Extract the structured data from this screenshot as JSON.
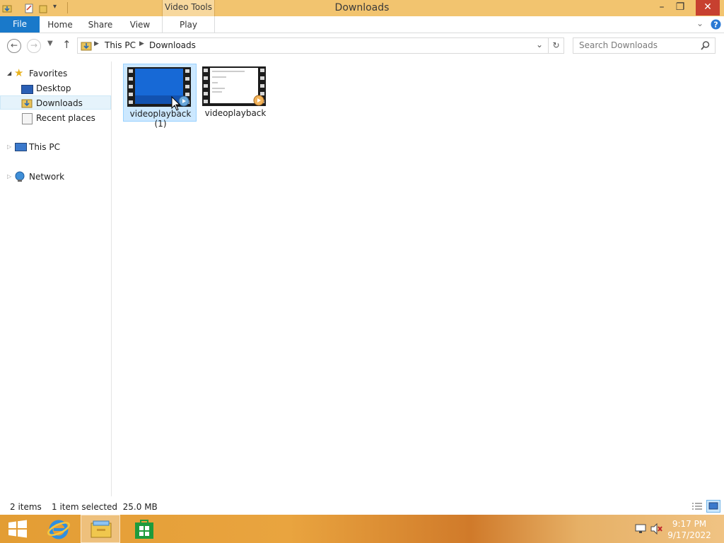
{
  "window": {
    "title": "Downloads",
    "context_tab_group": "Video Tools",
    "controls": {
      "minimize": "–",
      "restore": "❐",
      "close": "✕"
    }
  },
  "ribbon": {
    "file": "File",
    "tabs": [
      "Home",
      "Share",
      "View"
    ],
    "context_tab": "Play",
    "expand_icon": "chevron-down-icon",
    "help_icon": "help-icon"
  },
  "address": {
    "breadcrumb": [
      "This PC",
      "Downloads"
    ],
    "search_placeholder": "Search Downloads"
  },
  "nav": {
    "favorites": "Favorites",
    "favorites_items": [
      "Desktop",
      "Downloads",
      "Recent places"
    ],
    "this_pc": "This PC",
    "network": "Network"
  },
  "files": [
    {
      "name": "videoplayback (1)",
      "selected": true
    },
    {
      "name": "videoplayback",
      "selected": false
    }
  ],
  "status": {
    "items": "2 items",
    "selection": "1 item selected  25.0 MB"
  },
  "taskbar": {
    "time": "9:17 PM",
    "date": "9/17/2022"
  },
  "colors": {
    "titlebar": "#f2c46f",
    "file_tab": "#1979ca",
    "close_button": "#c7402f",
    "selection": "#cce8ff",
    "taskbar": "#e39d34"
  }
}
